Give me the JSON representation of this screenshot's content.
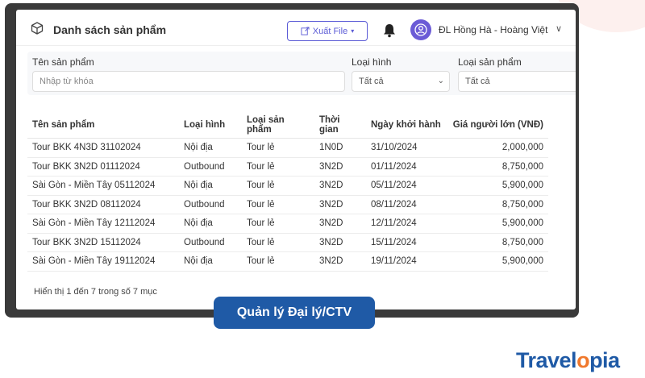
{
  "header": {
    "title": "Danh sách sản phẩm",
    "export_label": "Xuất File",
    "user_name": "ĐL Hồng Hà - Hoàng Việt"
  },
  "filters": {
    "product_name_label": "Tên sản phẩm",
    "product_name_placeholder": "Nhập từ khóa",
    "type_label": "Loại hình",
    "type_value": "Tất cả",
    "product_type_label": "Loại sản phẩm",
    "product_type_value": "Tất cả"
  },
  "table": {
    "headers": [
      "Tên sản phẩm",
      "Loại hình",
      "Loại sản phẩm",
      "Thời gian",
      "Ngày khởi hành",
      "Giá người lớn (VNĐ)"
    ],
    "rows": [
      [
        "Tour BKK 4N3D 31102024",
        "Nội địa",
        "Tour lẻ",
        "1N0D",
        "31/10/2024",
        "2,000,000"
      ],
      [
        "Tour BKK 3N2D 01112024",
        "Outbound",
        "Tour lẻ",
        "3N2D",
        "01/11/2024",
        "8,750,000"
      ],
      [
        "Sài Gòn - Miền Tây 05112024",
        "Nội địa",
        "Tour lẻ",
        "3N2D",
        "05/11/2024",
        "5,900,000"
      ],
      [
        "Tour BKK 3N2D 08112024",
        "Outbound",
        "Tour lẻ",
        "3N2D",
        "08/11/2024",
        "8,750,000"
      ],
      [
        "Sài Gòn - Miền Tây 12112024",
        "Nội địa",
        "Tour lẻ",
        "3N2D",
        "12/11/2024",
        "5,900,000"
      ],
      [
        "Tour BKK 3N2D 15112024",
        "Outbound",
        "Tour lẻ",
        "3N2D",
        "15/11/2024",
        "8,750,000"
      ],
      [
        "Sài Gòn - Miền Tây 19112024",
        "Nội địa",
        "Tour lẻ",
        "3N2D",
        "19/11/2024",
        "5,900,000"
      ]
    ],
    "footer": "Hiển thị 1 đến 7 trong số 7 mục"
  },
  "caption": "Quản lý Đại lý/CTV",
  "brand": {
    "part1": "Travel",
    "part2": "o",
    "part3": "pia"
  },
  "colors": {
    "accent": "#5b5bd6",
    "caption_bg": "#1f5aa6",
    "brand_blue": "#1f5aa6",
    "brand_orange": "#f0782c"
  }
}
